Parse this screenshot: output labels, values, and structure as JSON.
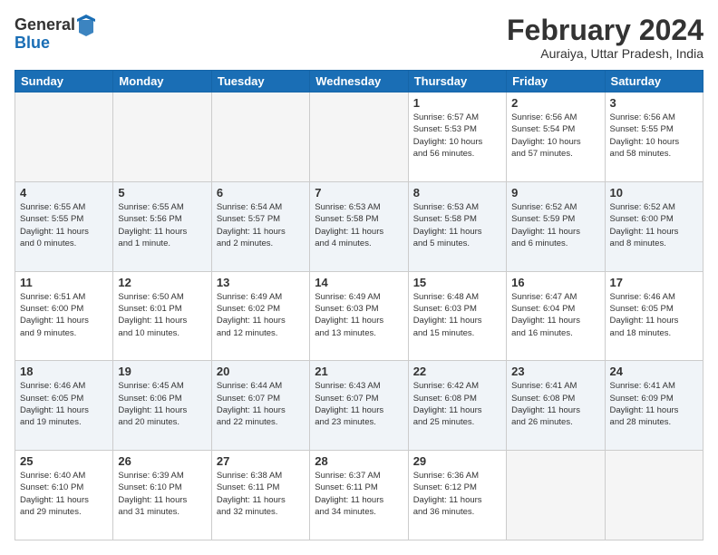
{
  "header": {
    "logo_general": "General",
    "logo_blue": "Blue",
    "month_title": "February 2024",
    "location": "Auraiya, Uttar Pradesh, India"
  },
  "calendar": {
    "days_of_week": [
      "Sunday",
      "Monday",
      "Tuesday",
      "Wednesday",
      "Thursday",
      "Friday",
      "Saturday"
    ],
    "weeks": [
      [
        {
          "day": "",
          "info": "",
          "empty": true
        },
        {
          "day": "",
          "info": "",
          "empty": true
        },
        {
          "day": "",
          "info": "",
          "empty": true
        },
        {
          "day": "",
          "info": "",
          "empty": true
        },
        {
          "day": "1",
          "info": "Sunrise: 6:57 AM\nSunset: 5:53 PM\nDaylight: 10 hours\nand 56 minutes.",
          "empty": false
        },
        {
          "day": "2",
          "info": "Sunrise: 6:56 AM\nSunset: 5:54 PM\nDaylight: 10 hours\nand 57 minutes.",
          "empty": false
        },
        {
          "day": "3",
          "info": "Sunrise: 6:56 AM\nSunset: 5:55 PM\nDaylight: 10 hours\nand 58 minutes.",
          "empty": false
        }
      ],
      [
        {
          "day": "4",
          "info": "Sunrise: 6:55 AM\nSunset: 5:55 PM\nDaylight: 11 hours\nand 0 minutes.",
          "empty": false
        },
        {
          "day": "5",
          "info": "Sunrise: 6:55 AM\nSunset: 5:56 PM\nDaylight: 11 hours\nand 1 minute.",
          "empty": false
        },
        {
          "day": "6",
          "info": "Sunrise: 6:54 AM\nSunset: 5:57 PM\nDaylight: 11 hours\nand 2 minutes.",
          "empty": false
        },
        {
          "day": "7",
          "info": "Sunrise: 6:53 AM\nSunset: 5:58 PM\nDaylight: 11 hours\nand 4 minutes.",
          "empty": false
        },
        {
          "day": "8",
          "info": "Sunrise: 6:53 AM\nSunset: 5:58 PM\nDaylight: 11 hours\nand 5 minutes.",
          "empty": false
        },
        {
          "day": "9",
          "info": "Sunrise: 6:52 AM\nSunset: 5:59 PM\nDaylight: 11 hours\nand 6 minutes.",
          "empty": false
        },
        {
          "day": "10",
          "info": "Sunrise: 6:52 AM\nSunset: 6:00 PM\nDaylight: 11 hours\nand 8 minutes.",
          "empty": false
        }
      ],
      [
        {
          "day": "11",
          "info": "Sunrise: 6:51 AM\nSunset: 6:00 PM\nDaylight: 11 hours\nand 9 minutes.",
          "empty": false
        },
        {
          "day": "12",
          "info": "Sunrise: 6:50 AM\nSunset: 6:01 PM\nDaylight: 11 hours\nand 10 minutes.",
          "empty": false
        },
        {
          "day": "13",
          "info": "Sunrise: 6:49 AM\nSunset: 6:02 PM\nDaylight: 11 hours\nand 12 minutes.",
          "empty": false
        },
        {
          "day": "14",
          "info": "Sunrise: 6:49 AM\nSunset: 6:03 PM\nDaylight: 11 hours\nand 13 minutes.",
          "empty": false
        },
        {
          "day": "15",
          "info": "Sunrise: 6:48 AM\nSunset: 6:03 PM\nDaylight: 11 hours\nand 15 minutes.",
          "empty": false
        },
        {
          "day": "16",
          "info": "Sunrise: 6:47 AM\nSunset: 6:04 PM\nDaylight: 11 hours\nand 16 minutes.",
          "empty": false
        },
        {
          "day": "17",
          "info": "Sunrise: 6:46 AM\nSunset: 6:05 PM\nDaylight: 11 hours\nand 18 minutes.",
          "empty": false
        }
      ],
      [
        {
          "day": "18",
          "info": "Sunrise: 6:46 AM\nSunset: 6:05 PM\nDaylight: 11 hours\nand 19 minutes.",
          "empty": false
        },
        {
          "day": "19",
          "info": "Sunrise: 6:45 AM\nSunset: 6:06 PM\nDaylight: 11 hours\nand 20 minutes.",
          "empty": false
        },
        {
          "day": "20",
          "info": "Sunrise: 6:44 AM\nSunset: 6:07 PM\nDaylight: 11 hours\nand 22 minutes.",
          "empty": false
        },
        {
          "day": "21",
          "info": "Sunrise: 6:43 AM\nSunset: 6:07 PM\nDaylight: 11 hours\nand 23 minutes.",
          "empty": false
        },
        {
          "day": "22",
          "info": "Sunrise: 6:42 AM\nSunset: 6:08 PM\nDaylight: 11 hours\nand 25 minutes.",
          "empty": false
        },
        {
          "day": "23",
          "info": "Sunrise: 6:41 AM\nSunset: 6:08 PM\nDaylight: 11 hours\nand 26 minutes.",
          "empty": false
        },
        {
          "day": "24",
          "info": "Sunrise: 6:41 AM\nSunset: 6:09 PM\nDaylight: 11 hours\nand 28 minutes.",
          "empty": false
        }
      ],
      [
        {
          "day": "25",
          "info": "Sunrise: 6:40 AM\nSunset: 6:10 PM\nDaylight: 11 hours\nand 29 minutes.",
          "empty": false
        },
        {
          "day": "26",
          "info": "Sunrise: 6:39 AM\nSunset: 6:10 PM\nDaylight: 11 hours\nand 31 minutes.",
          "empty": false
        },
        {
          "day": "27",
          "info": "Sunrise: 6:38 AM\nSunset: 6:11 PM\nDaylight: 11 hours\nand 32 minutes.",
          "empty": false
        },
        {
          "day": "28",
          "info": "Sunrise: 6:37 AM\nSunset: 6:11 PM\nDaylight: 11 hours\nand 34 minutes.",
          "empty": false
        },
        {
          "day": "29",
          "info": "Sunrise: 6:36 AM\nSunset: 6:12 PM\nDaylight: 11 hours\nand 36 minutes.",
          "empty": false
        },
        {
          "day": "",
          "info": "",
          "empty": true
        },
        {
          "day": "",
          "info": "",
          "empty": true
        }
      ]
    ]
  }
}
